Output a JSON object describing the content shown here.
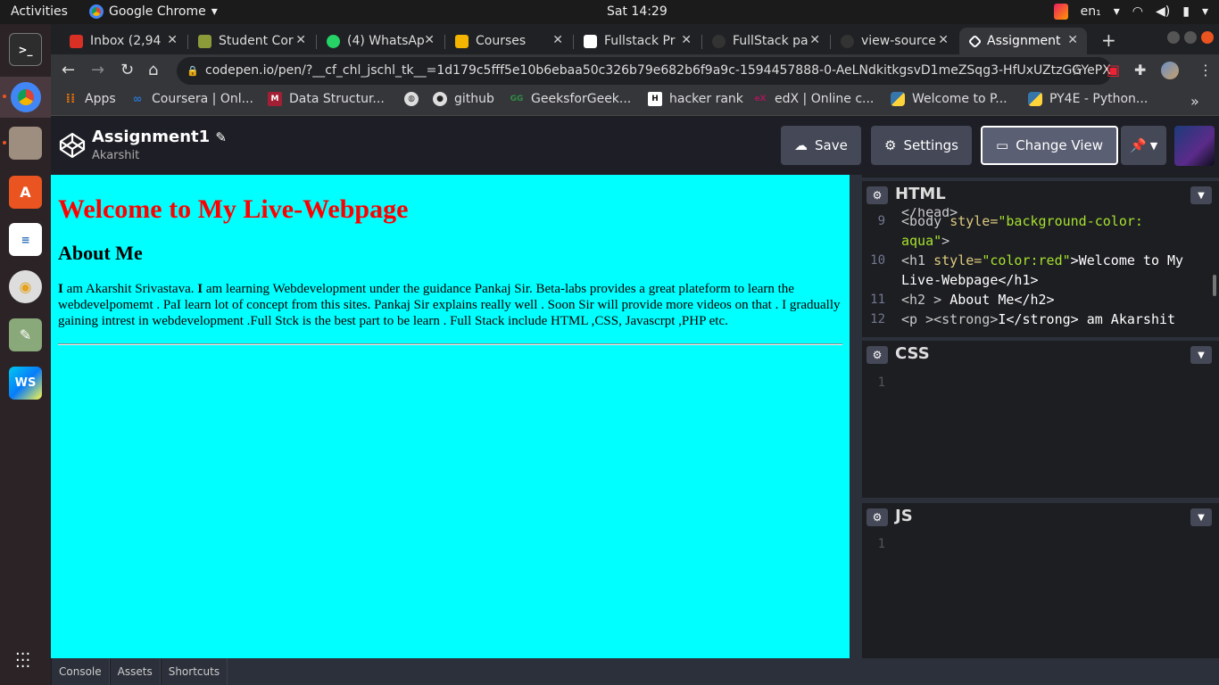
{
  "system_bar": {
    "activities": "Activities",
    "app_name": "Google Chrome",
    "clock": "Sat 14:29",
    "lang": "en₁"
  },
  "tabs": [
    {
      "title": "Inbox (2,94",
      "icon": "gmail-icon",
      "color": "#d93025"
    },
    {
      "title": "Student Cor",
      "icon": "student-icon",
      "color": "#8b9b3a"
    },
    {
      "title": "(4) WhatsAp",
      "icon": "whatsapp-icon",
      "color": "#25d366"
    },
    {
      "title": "Courses",
      "icon": "classroom-icon",
      "color": "#f4b400"
    },
    {
      "title": "Fullstack Pr",
      "icon": "profile-icon",
      "color": "#ffffff"
    },
    {
      "title": "FullStack pa",
      "icon": "loading-icon",
      "color": "#555555"
    },
    {
      "title": "view-source",
      "icon": "loading-icon",
      "color": "#555555"
    },
    {
      "title": "Assignment",
      "icon": "codepen-icon",
      "color": "#ffffff"
    }
  ],
  "address_bar": {
    "url": "codepen.io/pen/?__cf_chl_jschl_tk__=1d179c5fff5e10b6ebaa50c326b79e682b6f9a9c-1594457888-0-AeLNdkitkgsvD1meZSqg3-HfUxUZtzGGYePXLA..."
  },
  "bookmarks": [
    {
      "label": "Apps",
      "icon": "apps-grid-icon",
      "color": "#e8710a"
    },
    {
      "label": "Coursera | Onl...",
      "icon": "coursera-icon",
      "color": "#2a73cc"
    },
    {
      "label": "Data Structur...",
      "icon": "mit-icon",
      "color": "#a31f34"
    },
    {
      "label": "",
      "icon": "globe-icon",
      "color": "#555555"
    },
    {
      "label": "github",
      "icon": "github-icon",
      "color": "#222222"
    },
    {
      "label": "GeeksforGeek...",
      "icon": "gfg-icon",
      "color": "#2f8d46"
    },
    {
      "label": "hacker rank",
      "icon": "hackerrank-icon",
      "color": "#111111"
    },
    {
      "label": "edX | Online c...",
      "icon": "edx-icon",
      "color": "#a3195b"
    },
    {
      "label": "Welcome to P...",
      "icon": "python-icon",
      "color": "#3776ab"
    },
    {
      "label": "PY4E - Python...",
      "icon": "python-icon",
      "color": "#3776ab"
    }
  ],
  "codepen": {
    "title": "Assignment1",
    "user": "Akarshit",
    "save": "Save",
    "settings": "Settings",
    "change_view": "Change View"
  },
  "preview": {
    "h1": "Welcome to My Live-Webpage",
    "h2": "About Me",
    "strong1": "I",
    "text1": " am Akarshit Srivastava. ",
    "strong2": "I",
    "text2": " am learning Webdevelopment under the guidance Pankaj Sir. Beta-labs provides a great plateform to learn the webdevelpomemt . PaI learn lot of concept from this sites. Pankaj Sir explains really well . Soon Sir will provide more videos on that . I gradually gaining intrest in webdevelopment .Full Stck is the best part to be learn . Full Stack include HTML ,CSS, Javascrpt ,PHP etc."
  },
  "editors": {
    "html": {
      "label": "HTML",
      "partial_top": "</head>",
      "lines": [
        {
          "n": "9",
          "a": "<body ",
          "b": "style=",
          "c": "\"background-color:"
        },
        {
          "n": "",
          "a": "",
          "b": "",
          "c": "aqua\"",
          "d": ">"
        },
        {
          "n": "10",
          "a": "<h1 ",
          "b": "style=",
          "c": "\"color:red\"",
          "d": ">Welcome to My"
        },
        {
          "n": "",
          "a": "",
          "b": "",
          "c": "",
          "d": "Live-Webpage</h1>"
        },
        {
          "n": "11",
          "a": "<h2 > ",
          "b": "",
          "c": "",
          "d": "About Me</h2>"
        },
        {
          "n": "12",
          "a": "<p ><strong>",
          "b": "",
          "c": "",
          "d": "I</strong> am Akarshit"
        }
      ]
    },
    "css": {
      "label": "CSS",
      "line1": "1"
    },
    "js": {
      "label": "JS",
      "line1": "1"
    }
  },
  "footer": {
    "console": "Console",
    "assets": "Assets",
    "shortcuts": "Shortcuts"
  }
}
